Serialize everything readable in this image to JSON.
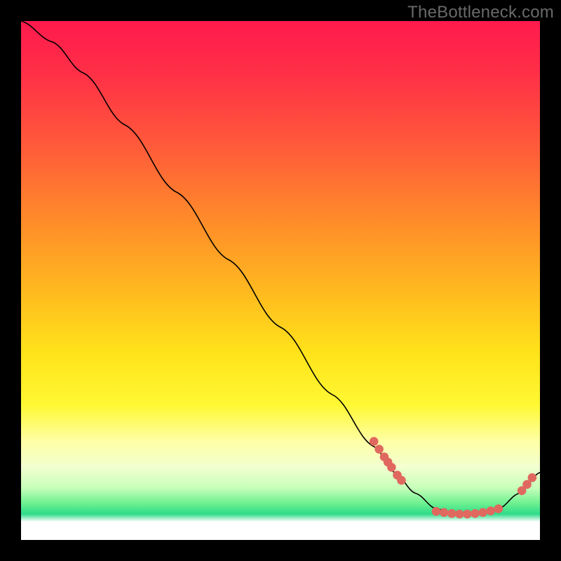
{
  "watermark": "TheBottleneck.com",
  "colors": {
    "marker": "#e0695f",
    "line": "#000000",
    "frame": "#000000"
  },
  "chart_data": {
    "type": "line",
    "title": "",
    "xlabel": "",
    "ylabel": "",
    "xlim": [
      0,
      100
    ],
    "ylim": [
      0,
      100
    ],
    "note": "No numeric axis labels are shown; values below are positions expressed as percentages of the plot area (0 = bottom-left, 100 = top-right), estimated from pixel geometry.",
    "series": [
      {
        "name": "curve",
        "x": [
          0,
          6,
          12,
          20,
          30,
          40,
          50,
          60,
          68,
          72,
          76,
          80,
          84,
          88,
          92,
          96,
          100
        ],
        "y": [
          100,
          96,
          90,
          80,
          67,
          54,
          41,
          28,
          18,
          13,
          9,
          6,
          5,
          5,
          6,
          9,
          13
        ]
      }
    ],
    "marker_clusters": [
      {
        "name": "left-slope-cluster",
        "points": [
          {
            "x": 68,
            "y": 19
          },
          {
            "x": 69,
            "y": 17.5
          },
          {
            "x": 70,
            "y": 16
          },
          {
            "x": 70.7,
            "y": 15
          },
          {
            "x": 71.4,
            "y": 14
          },
          {
            "x": 72.5,
            "y": 12.5
          },
          {
            "x": 73.3,
            "y": 11.5
          }
        ]
      },
      {
        "name": "trough-cluster",
        "points": [
          {
            "x": 80,
            "y": 5.5
          },
          {
            "x": 81.5,
            "y": 5.3
          },
          {
            "x": 83,
            "y": 5.1
          },
          {
            "x": 84.5,
            "y": 5
          },
          {
            "x": 86,
            "y": 5
          },
          {
            "x": 87.5,
            "y": 5.1
          },
          {
            "x": 89,
            "y": 5.3
          },
          {
            "x": 90.5,
            "y": 5.6
          },
          {
            "x": 92,
            "y": 6
          }
        ]
      },
      {
        "name": "right-rise-cluster",
        "points": [
          {
            "x": 96.5,
            "y": 9.5
          },
          {
            "x": 97.5,
            "y": 10.7
          },
          {
            "x": 98.5,
            "y": 12
          }
        ]
      }
    ]
  }
}
